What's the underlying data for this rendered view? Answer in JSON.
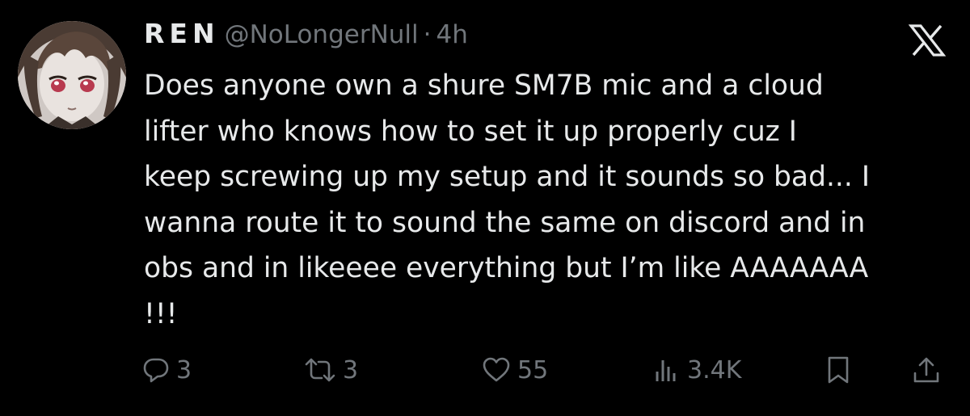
{
  "tweet": {
    "author": {
      "display_name": "REN",
      "handle": "@NoLongerNull",
      "separator": "·",
      "time": "4h",
      "avatar_icon": "anime-avatar"
    },
    "text_lines": [
      "Does anyone own a shure SM7B mic and a cloud",
      "lifter who knows how to set it up properly cuz I",
      "keep screwing up my setup and it sounds so bad... I",
      "wanna route it to sound the same on discord and in",
      "obs and in likeeee everything but I’m like AAAAAAA",
      "!!!"
    ],
    "actions": {
      "reply_count": "3",
      "retweet_count": "3",
      "like_count": "55",
      "views_count": "3.4K"
    }
  },
  "icons": {
    "brand": "x-logo-icon",
    "reply": "reply-icon",
    "retweet": "retweet-icon",
    "like": "heart-icon",
    "views": "views-icon",
    "bookmark": "bookmark-icon",
    "share": "share-icon"
  },
  "colors": {
    "background": "#000000",
    "primary_text": "#e7e9ea",
    "secondary_text": "#71767b"
  }
}
